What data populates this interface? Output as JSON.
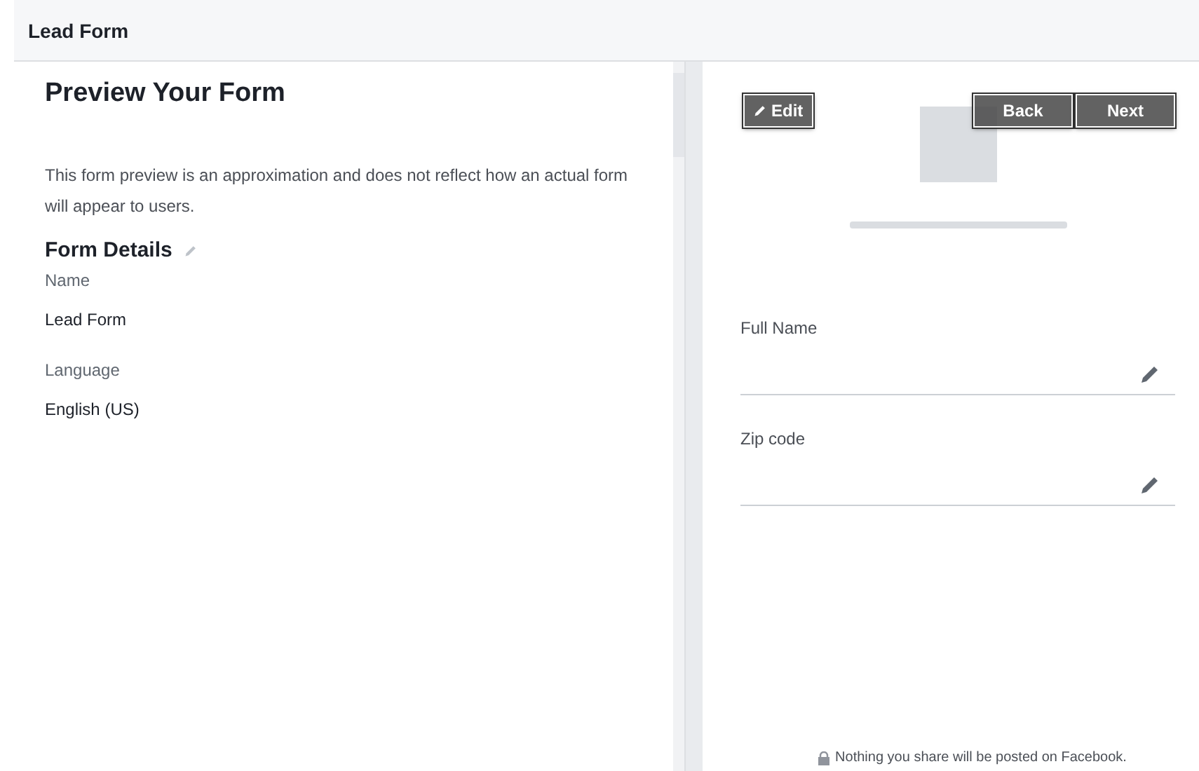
{
  "header": {
    "title": "Lead Form"
  },
  "left": {
    "title": "Preview Your Form",
    "description": "This form preview is an approximation and does not reflect how an actual form will appear to users.",
    "section_title": "Form Details",
    "details": [
      {
        "label": "Name",
        "value": "Lead Form"
      },
      {
        "label": "Language",
        "value": "English (US)"
      }
    ]
  },
  "preview": {
    "toolbar": [
      {
        "label": "Edit",
        "kind": "edit"
      },
      {
        "label": "Back",
        "kind": "nav"
      },
      {
        "label": "Next",
        "kind": "nav"
      }
    ],
    "fields": [
      {
        "label": "Full Name"
      },
      {
        "label": "Zip code"
      }
    ],
    "footer": "Nothing you share will be posted on Facebook."
  }
}
